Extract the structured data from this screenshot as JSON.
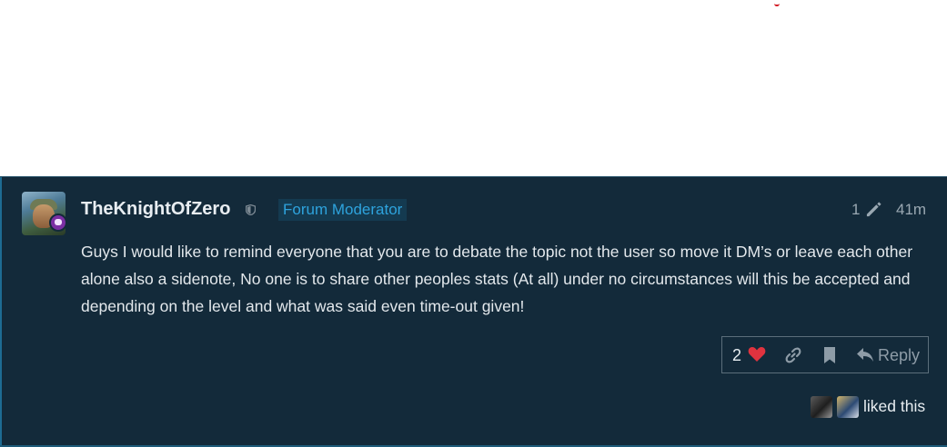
{
  "post": {
    "username": "TheKnightOfZero",
    "badge": "Forum Moderator",
    "edit_count": "1",
    "timestamp": "41m",
    "body": "Guys I would like to remind everyone that you are to debate the topic not the user so move it DM’s or leave each other alone also a sidenote, No one is to share other peoples stats (At all) under no circumstances will this be accepted and depending on the level and what was said even time-out given!",
    "likes": "2",
    "reply_label": "Reply",
    "liked_text": "liked this"
  },
  "colors": {
    "post_bg": "#132a3a",
    "badge_text": "#2ea3dd",
    "heart": "#e0333f",
    "text": "#e3e8ec",
    "muted": "#9aa8b2"
  },
  "icons": [
    "shield-icon",
    "pencil-icon",
    "heart-icon",
    "link-icon",
    "bookmark-icon",
    "reply-icon"
  ]
}
